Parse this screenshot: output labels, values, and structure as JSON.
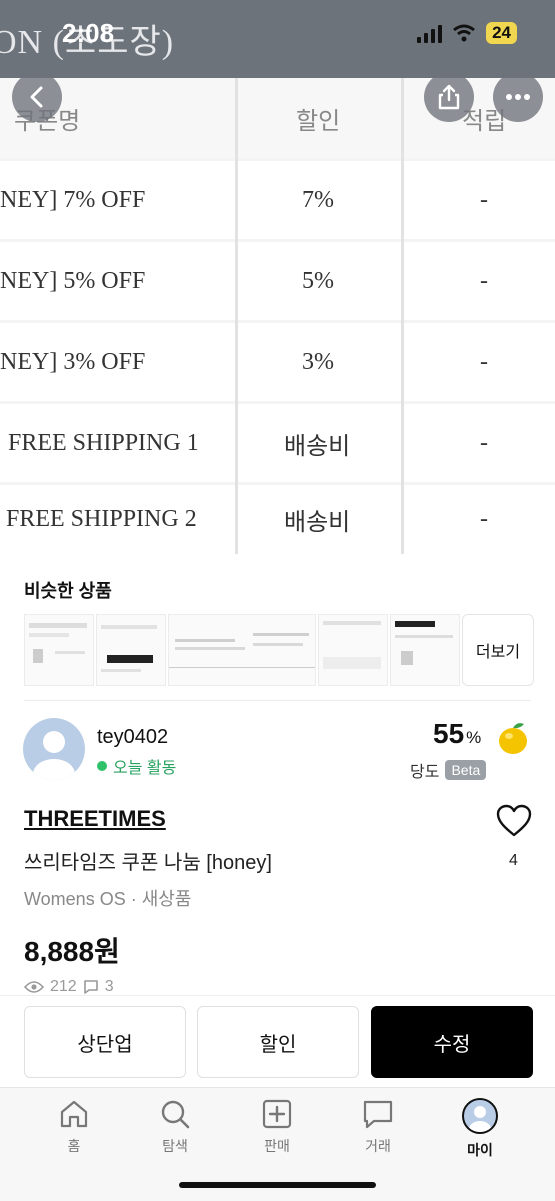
{
  "status_bar": {
    "time": "2:08",
    "battery": "24",
    "bg_text": "ON (초도장)"
  },
  "coupon_table": {
    "headers": [
      "쿠폰명",
      "할인",
      "적립"
    ],
    "rows": [
      {
        "name": "NEY] 7% OFF",
        "discount": "7%",
        "points": "-"
      },
      {
        "name": "NEY] 5% OFF",
        "discount": "5%",
        "points": "-"
      },
      {
        "name": "NEY] 3% OFF",
        "discount": "3%",
        "points": "-"
      },
      {
        "name": "FREE SHIPPING 1",
        "discount": "배송비",
        "points": "-"
      },
      {
        "name": "FREE SHIPPING 2",
        "discount": "배송비",
        "points": "-"
      }
    ]
  },
  "similar": {
    "title": "비슷한 상품",
    "more_label": "더보기"
  },
  "seller": {
    "name": "tey0402",
    "activity": "오늘 활동",
    "score": "55",
    "score_unit": "%",
    "sweetness_label": "당도",
    "beta": "Beta"
  },
  "product": {
    "brand": "THREETIMES",
    "title": "쓰리타임즈 쿠폰 나눔 [honey]",
    "category": "Womens OS · 새상품",
    "price": "8,888원",
    "views": "212",
    "chats": "3",
    "likes": "4"
  },
  "actions": {
    "bump": "상단업",
    "discount": "할인",
    "edit": "수정"
  },
  "tabs": {
    "home": "홈",
    "explore": "탐색",
    "sell": "판매",
    "trade": "거래",
    "my": "마이"
  },
  "colors": {
    "accent": "#000000",
    "online": "#2fc26b",
    "status_bg": "#6d737b"
  }
}
